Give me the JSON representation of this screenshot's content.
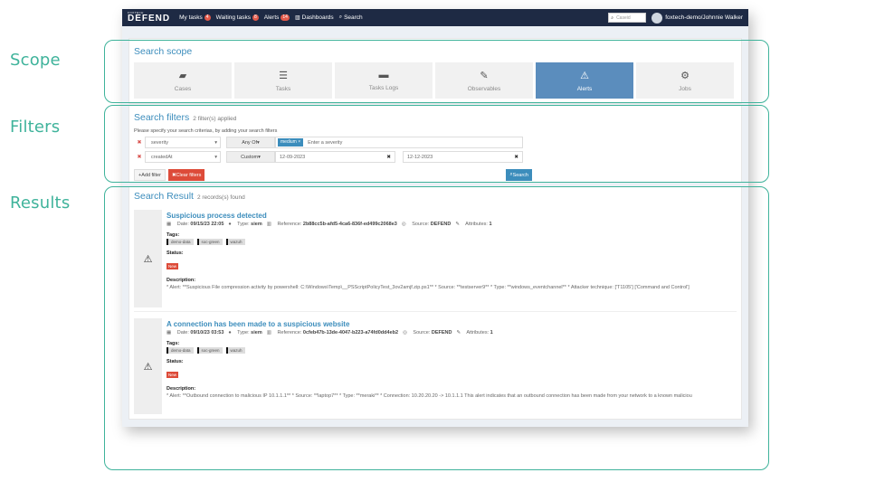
{
  "annotations": {
    "scope": "Scope",
    "filters": "Filters",
    "results": "Results"
  },
  "topbar": {
    "brand_small": "FOXTECH",
    "brand_big": "DEFEND",
    "my_tasks": "My tasks",
    "my_tasks_count": "4",
    "waiting_tasks": "Waiting tasks",
    "waiting_tasks_count": "8",
    "alerts": "Alerts",
    "alerts_count": "14",
    "dashboards": "Dashboards",
    "search": "Search",
    "caseid_placeholder": "Caseid",
    "user": "foxtech-demo/Johnnie Walker"
  },
  "scope": {
    "title": "Search scope",
    "tabs": [
      {
        "label": "Cases",
        "icon": "folder-open-icon"
      },
      {
        "label": "Tasks",
        "icon": "tasks-icon"
      },
      {
        "label": "Tasks Logs",
        "icon": "comment-icon"
      },
      {
        "label": "Observables",
        "icon": "pin-icon"
      },
      {
        "label": "Alerts",
        "icon": "warning-icon"
      },
      {
        "label": "Jobs",
        "icon": "gear-icon"
      }
    ]
  },
  "filters": {
    "title": "Search filters",
    "applied": "2 filter(s) applied",
    "hint": "Please specify your search criterias, by adding your search filters",
    "row1": {
      "field": "severity",
      "op": "Any Of",
      "chip": "medium",
      "placeholder": "Enter a severity"
    },
    "row2": {
      "field": "createdAt",
      "op": "Custom",
      "from": "12-09-2023",
      "to": "12-12-2023"
    },
    "add_label": "Add filter",
    "clear_label": "Clear filters",
    "search_label": "Search"
  },
  "results": {
    "title": "Search Result",
    "count": "2 records(s) found",
    "records": [
      {
        "title": "Suspicious process detected",
        "date": "09/15/23 22:05",
        "type": "siem",
        "reference": "2b88cc5b-afd5-4ca6-836f-ed499c2068e3",
        "source": "DEFEND",
        "attributes": "1",
        "tags": [
          "demo-data",
          "soc-green",
          "wazuh"
        ],
        "status": "New",
        "description": "* Alert: **Suspicious File compression activity by powershell: C:\\Windows\\Temp\\__PSScriptPolicyTest_3ov2amjf.zip.ps1** * Source: **testserver9** * Type: **windows_eventchannel** * Attacker technique: ['T1105'] ['Command and Control']"
      },
      {
        "title": "A connection has been made to a suspicious website",
        "date": "09/10/23 03:53",
        "type": "siem",
        "reference": "0cfeb47b-13de-4047-b223-a74fd0dd4eb2",
        "source": "DEFEND",
        "attributes": "1",
        "tags": [
          "demo-data",
          "soc-green",
          "wazuh"
        ],
        "status": "New",
        "description": "* Alert: **Outbound connection to malicious IP 10.1.1.1** * Source: **laptop7** * Type: **meraki** * Connection: 10.20.20.20 -> 10.1.1.1 This alert indicates that an outbound connection has been made from your network to a known maliciou"
      }
    ]
  }
}
